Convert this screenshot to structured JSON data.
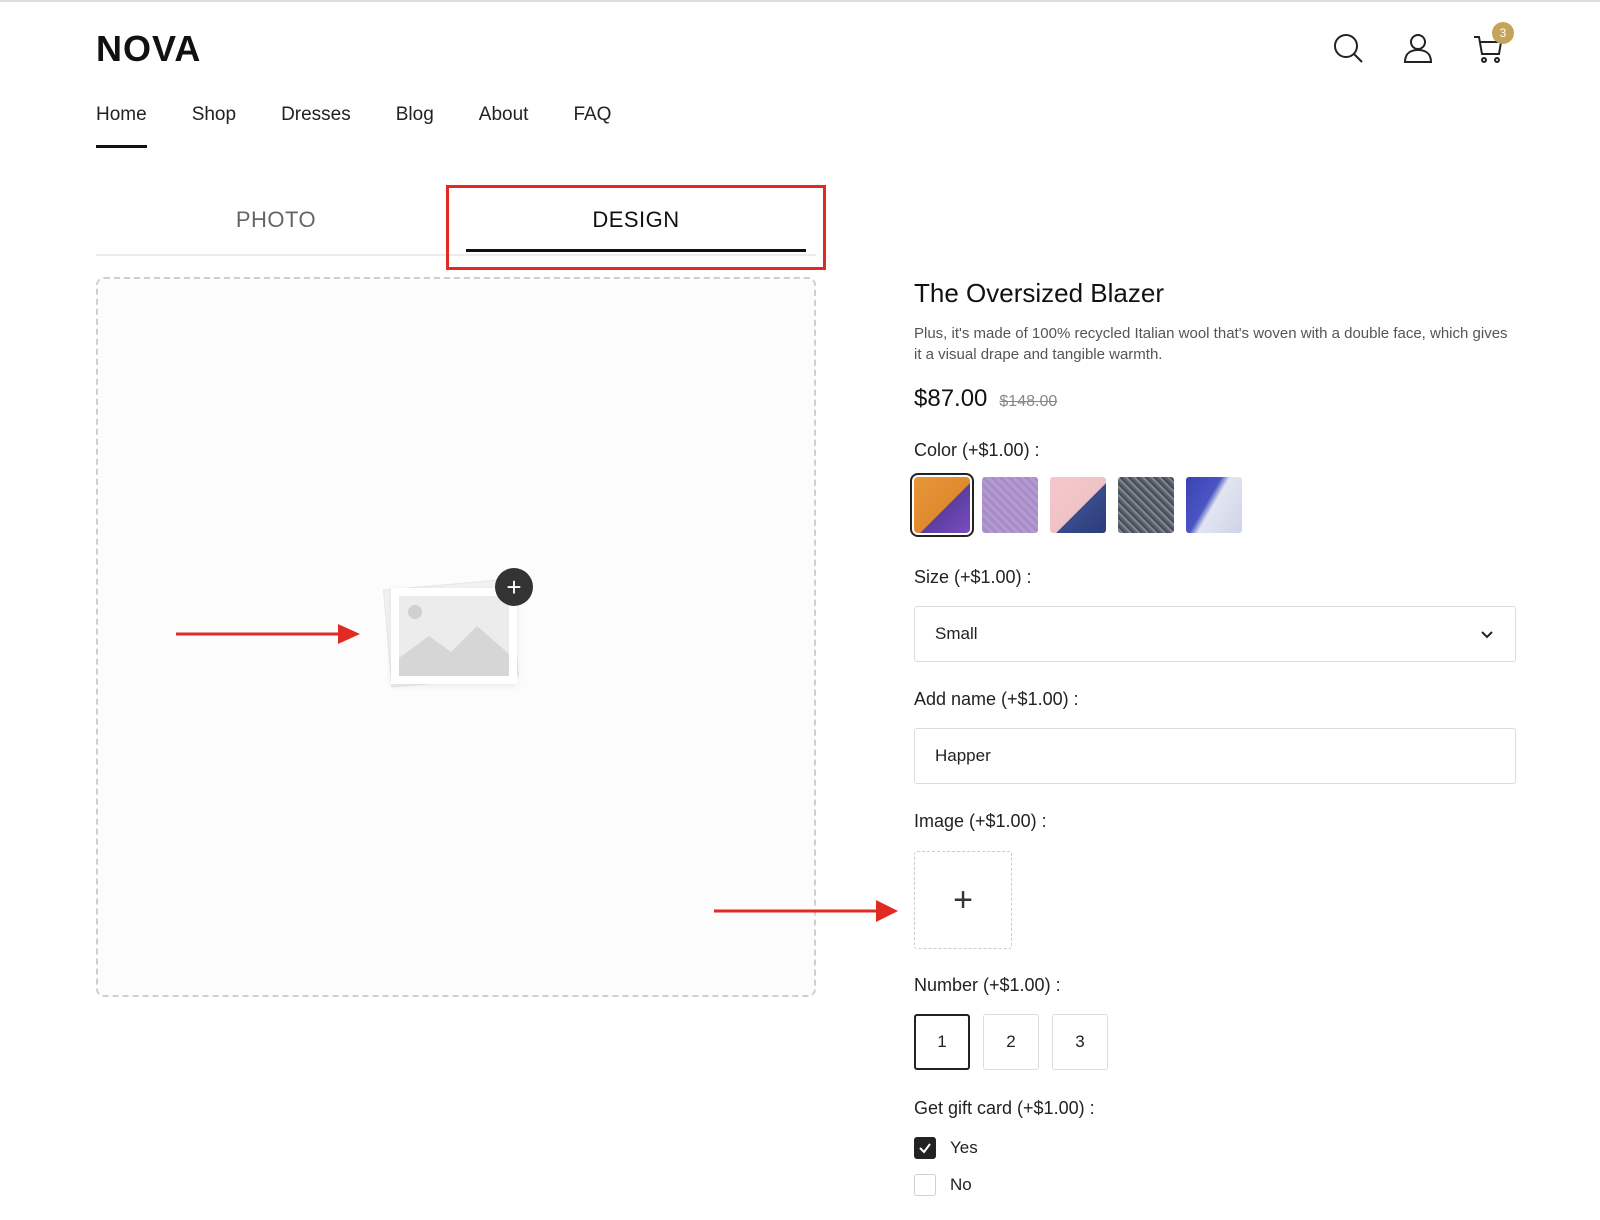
{
  "header": {
    "logo": "NOVA",
    "cart_count": "3",
    "icons": [
      "search-icon",
      "user-icon",
      "cart-icon"
    ],
    "badge_color": "#c5a358"
  },
  "nav": {
    "items": [
      {
        "label": "Home",
        "active": true
      },
      {
        "label": "Shop"
      },
      {
        "label": "Dresses"
      },
      {
        "label": "Blog"
      },
      {
        "label": "About"
      },
      {
        "label": "FAQ"
      }
    ]
  },
  "tabs": [
    {
      "label": "PHOTO"
    },
    {
      "label": "DESIGN",
      "active": true
    }
  ],
  "highlight_color": "#e02a22",
  "product": {
    "title": "The Oversized Blazer",
    "description": "Plus, it's made of 100% recycled Italian wool that's woven with a double face, which gives it a visual drape and tangible warmth.",
    "price": "$87.00",
    "old_price": "$148.00"
  },
  "options": {
    "color": {
      "label": "Color  (+$1.00) :",
      "selected_index": 0,
      "swatch_count": 5
    },
    "size": {
      "label": "Size  (+$1.00) :",
      "value": "Small"
    },
    "name": {
      "label": "Add name  (+$1.00) :",
      "value": "Happer"
    },
    "image": {
      "label": "Image  (+$1.00) :",
      "button": "+"
    },
    "number": {
      "label": "Number  (+$1.00) :",
      "values": [
        "1",
        "2",
        "3"
      ],
      "selected_index": 0
    },
    "gift": {
      "label": "Get gift card  (+$1.00) :",
      "choices": [
        {
          "label": "Yes",
          "checked": true
        },
        {
          "label": "No",
          "checked": false
        }
      ]
    }
  }
}
